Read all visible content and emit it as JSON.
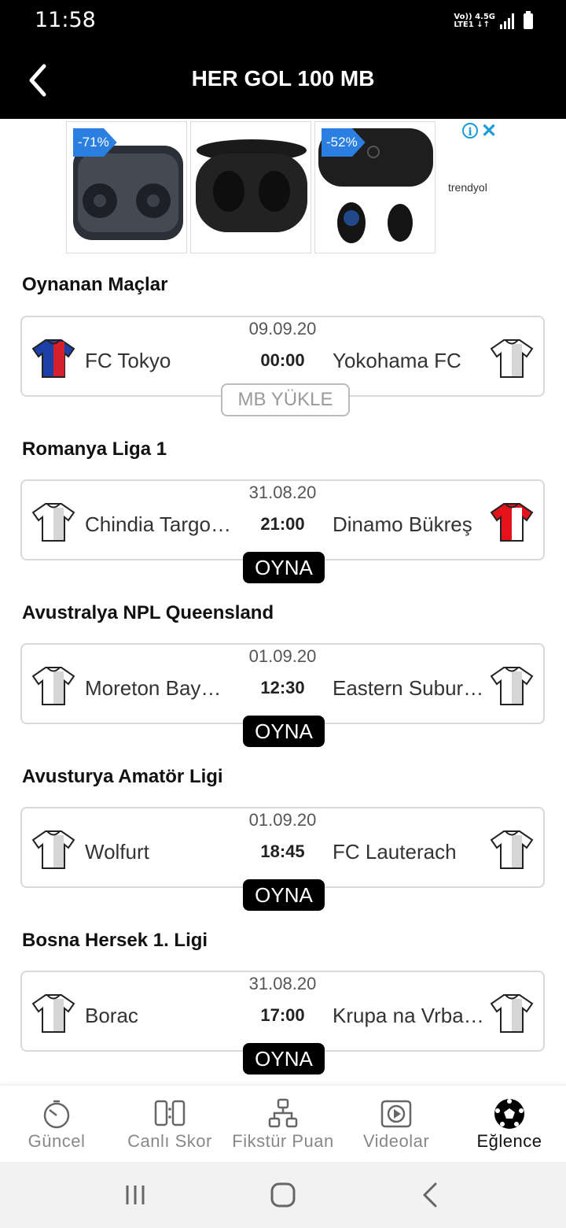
{
  "status_bar": {
    "time": "11:58",
    "network_line1": "Vo)) 4.5G",
    "network_line2": "LTE1 ↓↑"
  },
  "header": {
    "title": "HER GOL 100 MB"
  },
  "ad": {
    "tiles": [
      {
        "discount": "-71%"
      },
      {
        "discount": ""
      },
      {
        "discount": "-52%"
      }
    ],
    "brand": "trendyol",
    "info_icon": "i",
    "close_icon": "✕"
  },
  "sections": [
    {
      "title": "Oynanan Maçlar",
      "match": {
        "date": "09.09.20",
        "time": "00:00",
        "home": "FC Tokyo",
        "away": "Yokohama FC",
        "button": "MB YÜKLE"
      }
    },
    {
      "title": "Romanya Liga 1",
      "match": {
        "date": "31.08.20",
        "time": "21:00",
        "home": "Chindia Targo…",
        "away": "Dinamo Bükreş",
        "button": "OYNA"
      }
    },
    {
      "title": "Avustralya NPL Queensland",
      "match": {
        "date": "01.09.20",
        "time": "12:30",
        "home": "Moreton Bay…",
        "away": "Eastern Subur…",
        "button": "OYNA"
      }
    },
    {
      "title": "Avusturya Amatör Ligi",
      "match": {
        "date": "01.09.20",
        "time": "18:45",
        "home": "Wolfurt",
        "away": "FC Lauterach",
        "button": "OYNA"
      }
    },
    {
      "title": "Bosna Hersek 1. Ligi",
      "match": {
        "date": "31.08.20",
        "time": "17:00",
        "home": "Borac",
        "away": "Krupa na Vrba…",
        "button": "OYNA"
      }
    }
  ],
  "jersey_colors": {
    "fc_tokyo": [
      "#1d3fa8",
      "#d4202c"
    ],
    "dinamo": [
      "#e4121a",
      "#ffffff"
    ],
    "default": [
      "#ffffff",
      "#d6d6d6"
    ]
  },
  "bottom_nav": {
    "items": [
      {
        "label": "Güncel",
        "icon": "timer-icon"
      },
      {
        "label": "Canlı Skor",
        "icon": "scoreboard-icon"
      },
      {
        "label": "Fikstür Puan",
        "icon": "bracket-icon"
      },
      {
        "label": "Videolar",
        "icon": "play-icon"
      },
      {
        "label": "Eğlence",
        "icon": "soccer-ball-icon"
      }
    ],
    "active_index": 4
  }
}
